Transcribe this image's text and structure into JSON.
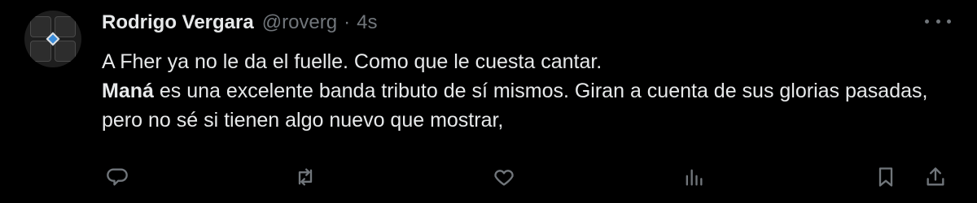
{
  "author": {
    "name": "Rodrigo Vergara",
    "handle": "@roverg",
    "separator": "·",
    "timestamp": "4s"
  },
  "post": {
    "line1": "A Fher ya no le da el fuelle. Como que le cuesta cantar.",
    "mention_bold": "Maná",
    "line2_rest": " es una excelente banda tributo de sí mismos. Giran a cuenta de sus glorias pasadas, pero no sé si tienen algo nuevo que mostrar,"
  },
  "icons": {
    "more": "more-icon",
    "reply": "reply-icon",
    "repost": "repost-icon",
    "like": "heart-icon",
    "views": "views-icon",
    "bookmark": "bookmark-icon",
    "share": "share-icon"
  },
  "colors": {
    "background": "#000000",
    "primary_text": "#e7e9ea",
    "secondary_text": "#71767b"
  }
}
